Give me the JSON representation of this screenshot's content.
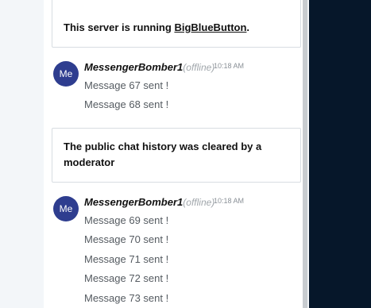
{
  "system_messages": {
    "server_notice": {
      "prefix": "This server is running ",
      "link": "BigBlueButton",
      "suffix": "."
    },
    "history_cleared": {
      "line1": "The public chat history was cleared by a",
      "line2": "moderator"
    }
  },
  "message_groups": [
    {
      "avatar": "Me",
      "sender": "MessengerBomber1",
      "status": "(offline)",
      "time": "10:18 AM",
      "messages": [
        "Message 67 sent !",
        "Message 68 sent !"
      ]
    },
    {
      "avatar": "Me",
      "sender": "MessengerBomber1",
      "status": "(offline)",
      "time": "10:18 AM",
      "messages": [
        "Message 69 sent !",
        "Message 70 sent !",
        "Message 71 sent !",
        "Message 72 sent !",
        "Message 73 sent !"
      ]
    }
  ],
  "colors": {
    "avatar_bg": "#2e3d8f",
    "right_panel_bg": "#06172a",
    "scrollbar": "#c8ccd0"
  }
}
